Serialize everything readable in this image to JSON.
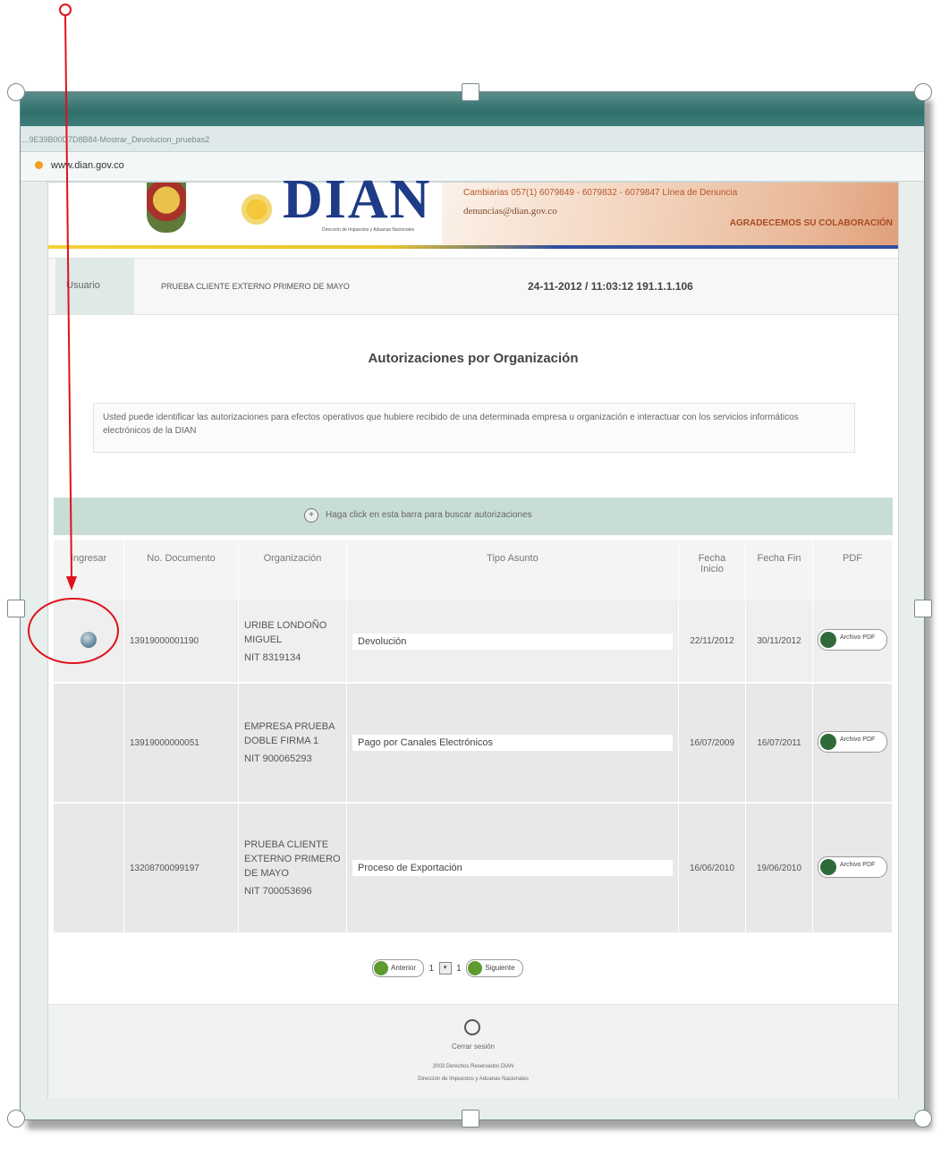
{
  "browser": {
    "tab_text": "...9E39B00D7D8B84-Mostrar_Devolucion_pruebas2",
    "url": "www.dian.gov.co"
  },
  "banner": {
    "logo_text": "DIAN",
    "logo_subtitle": "Dirección de Impuestos y Aduanas Nacionales",
    "contact_line": "Cambiarias 057(1) 6079849 - 6079832 - 6079847 Línea de Denuncia",
    "contact_email": "denuncias@dian.gov.co",
    "thanks": "AGRADECEMOS SU COLABORACIÓN"
  },
  "user": {
    "label": "Usuario",
    "name": "PRUEBA CLIENTE EXTERNO PRIMERO DE MAYO",
    "stamp": "24-11-2012 / 11:03:12 191.1.1.106"
  },
  "page": {
    "title": "Autorizaciones por Organización",
    "description": "Usted puede identificar las autorizaciones para efectos operativos que hubiere recibido de una determinada empresa u organización e interactuar con los servicios informáticos electrónicos de la DIAN",
    "search_bar_text": "Haga click en esta barra para buscar autorizaciones"
  },
  "table": {
    "headers": {
      "ingresar": "Ingresar",
      "documento": "No. Documento",
      "organizacion": "Organización",
      "asunto": "Tipo Asunto",
      "inicio": "Fecha Inicio",
      "fin": "Fecha Fin",
      "pdf": "PDF"
    },
    "rows": [
      {
        "documento": "13919000001190",
        "organizacion": "URIBE LONDOÑO MIGUEL",
        "nit": "NIT 8319134",
        "asunto": "Devolución",
        "inicio": "22/11/2012",
        "fin": "30/11/2012",
        "pdf_label": "Archivo PDF"
      },
      {
        "documento": "13919000000051",
        "organizacion": "EMPRESA PRUEBA DOBLE FIRMA 1",
        "nit": "NIT 900065293",
        "asunto": "Pago por Canales Electrónicos",
        "inicio": "16/07/2009",
        "fin": "16/07/2011",
        "pdf_label": "Archivo PDF"
      },
      {
        "documento": "13208700099197",
        "organizacion": "PRUEBA CLIENTE EXTERNO PRIMERO DE MAYO",
        "nit": "NIT 700053696",
        "asunto": "Proceso de Exportación",
        "inicio": "16/06/2010",
        "fin": "19/06/2010",
        "pdf_label": "Archivo PDF"
      }
    ]
  },
  "pager": {
    "prev": "Anterior",
    "current": "1",
    "total": "1",
    "next": "Siguiente"
  },
  "footer": {
    "logout": "Cerrar sesión",
    "copyright": "2003 Derechos Reservados DIAN",
    "org": "Dirección de Impuestos y Aduanas Nacionales"
  },
  "colors": {
    "annotation": "#e0121b",
    "dian_blue": "#1d3b86",
    "search_bar": "#c9ddd7"
  }
}
